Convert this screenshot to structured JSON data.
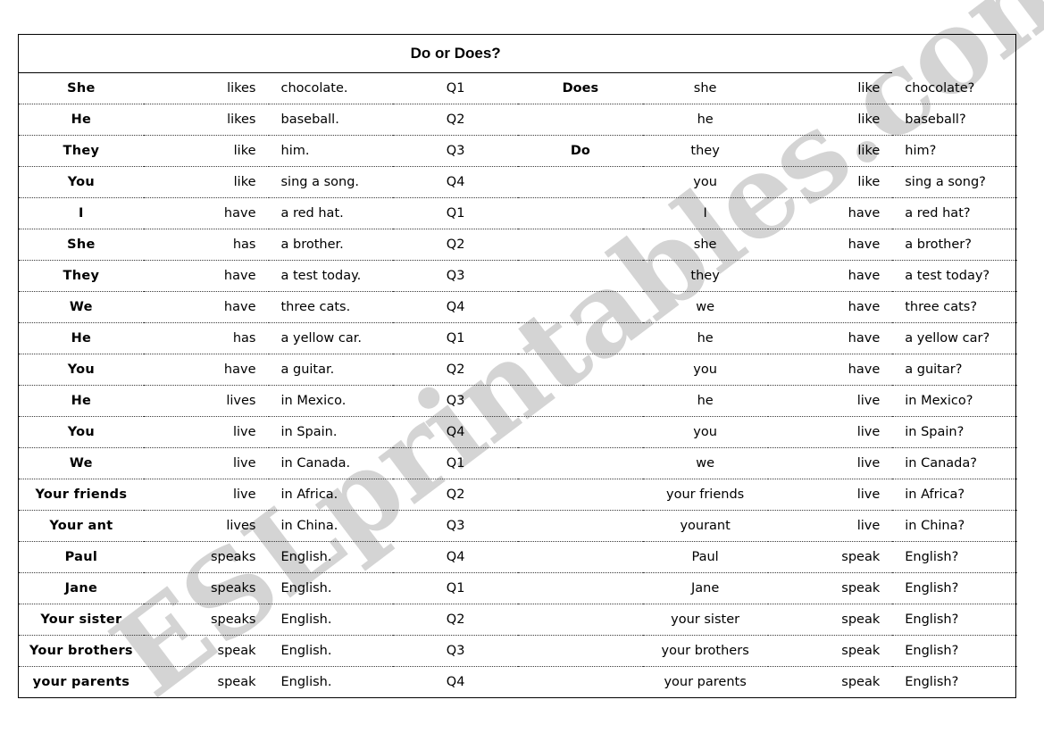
{
  "header": {
    "title": "Do or Does?"
  },
  "watermark": {
    "text": "ESLprintables.com"
  },
  "colors": {
    "answer_red": "#cc0000",
    "text_black": "#000000",
    "watermark_gray": "#c9c9c9"
  },
  "rows": [
    {
      "subject": "She",
      "verb": "likes",
      "object": "chocolate.",
      "qnum": "Q1",
      "answer": "Does",
      "rsubject": "she",
      "rverb": "like",
      "robject": "chocolate?"
    },
    {
      "subject": "He",
      "verb": "likes",
      "object": "baseball.",
      "qnum": "Q2",
      "answer": "",
      "rsubject": "he",
      "rverb": "like",
      "robject": "baseball?"
    },
    {
      "subject": "They",
      "verb": "like",
      "object": "him.",
      "qnum": "Q3",
      "answer": "Do",
      "rsubject": "they",
      "rverb": "like",
      "robject": "him?"
    },
    {
      "subject": "You",
      "verb": "like",
      "object": "sing a song.",
      "qnum": "Q4",
      "answer": "",
      "rsubject": "you",
      "rverb": "like",
      "robject": "sing a song?"
    },
    {
      "subject": "I",
      "verb": "have",
      "object": "a red hat.",
      "qnum": "Q1",
      "answer": "",
      "rsubject": "I",
      "rverb": "have",
      "robject": "a red hat?"
    },
    {
      "subject": "She",
      "verb": "has",
      "object": "a brother.",
      "qnum": "Q2",
      "answer": "",
      "rsubject": "she",
      "rverb": "have",
      "robject": "a brother?"
    },
    {
      "subject": "They",
      "verb": "have",
      "object": "a test today.",
      "qnum": "Q3",
      "answer": "",
      "rsubject": "they",
      "rverb": "have",
      "robject": "a test today?"
    },
    {
      "subject": "We",
      "verb": "have",
      "object": "three cats.",
      "qnum": "Q4",
      "answer": "",
      "rsubject": "we",
      "rverb": "have",
      "robject": "three cats?"
    },
    {
      "subject": "He",
      "verb": "has",
      "object": "a yellow car.",
      "qnum": "Q1",
      "answer": "",
      "rsubject": "he",
      "rverb": "have",
      "robject": "a yellow car?"
    },
    {
      "subject": "You",
      "verb": "have",
      "object": "a guitar.",
      "qnum": "Q2",
      "answer": "",
      "rsubject": "you",
      "rverb": "have",
      "robject": "a guitar?"
    },
    {
      "subject": "He",
      "verb": "lives",
      "object": "in Mexico.",
      "qnum": "Q3",
      "answer": "",
      "rsubject": "he",
      "rverb": "live",
      "robject": "in Mexico?"
    },
    {
      "subject": "You",
      "verb": "live",
      "object": "in Spain.",
      "qnum": "Q4",
      "answer": "",
      "rsubject": "you",
      "rverb": "live",
      "robject": "in Spain?"
    },
    {
      "subject": "We",
      "verb": "live",
      "object": "in Canada.",
      "qnum": "Q1",
      "answer": "",
      "rsubject": "we",
      "rverb": "live",
      "robject": "in Canada?"
    },
    {
      "subject": "Your friends",
      "verb": "live",
      "object": "in Africa.",
      "qnum": "Q2",
      "answer": "",
      "rsubject": "your friends",
      "rverb": "live",
      "robject": "in Africa?"
    },
    {
      "subject": "Your ant",
      "verb": "lives",
      "object": "in China.",
      "qnum": "Q3",
      "answer": "",
      "rsubject": "yourant",
      "rverb": "live",
      "robject": "in China?"
    },
    {
      "subject": "Paul",
      "verb": "speaks",
      "object": "English.",
      "qnum": "Q4",
      "answer": "",
      "rsubject": "Paul",
      "rverb": "speak",
      "robject": "English?"
    },
    {
      "subject": "Jane",
      "verb": "speaks",
      "object": "English.",
      "qnum": "Q1",
      "answer": "",
      "rsubject": "Jane",
      "rverb": "speak",
      "robject": "English?"
    },
    {
      "subject": "Your sister",
      "verb": "speaks",
      "object": "English.",
      "qnum": "Q2",
      "answer": "",
      "rsubject": "your sister",
      "rverb": "speak",
      "robject": "English?"
    },
    {
      "subject": "Your brothers",
      "verb": "speak",
      "object": "English.",
      "qnum": "Q3",
      "answer": "",
      "rsubject": "your brothers",
      "rverb": "speak",
      "robject": "English?"
    },
    {
      "subject": "your parents",
      "verb": "speak",
      "object": "English.",
      "qnum": "Q4",
      "answer": "",
      "rsubject": "your parents",
      "rverb": "speak",
      "robject": "English?"
    }
  ]
}
